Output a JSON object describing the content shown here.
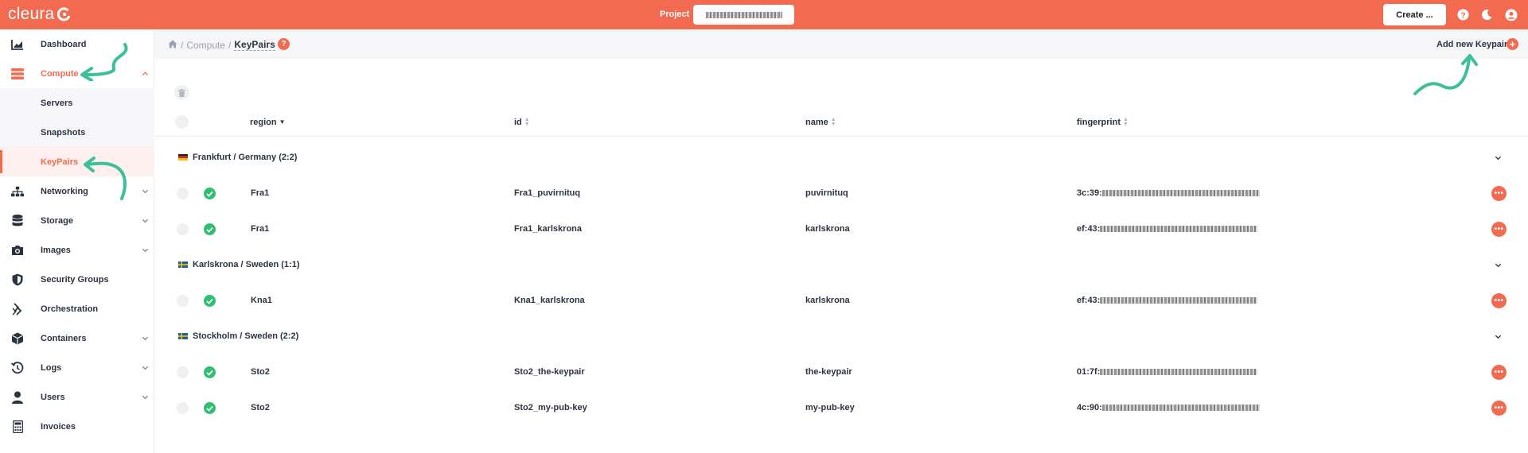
{
  "app": {
    "brand": "cleura"
  },
  "topbar": {
    "project_label": "Project",
    "create_label": "Create ..."
  },
  "sidebar": {
    "items": [
      {
        "label": "Dashboard"
      },
      {
        "label": "Compute"
      },
      {
        "label": "Servers"
      },
      {
        "label": "Snapshots"
      },
      {
        "label": "KeyPairs"
      },
      {
        "label": "Networking"
      },
      {
        "label": "Storage"
      },
      {
        "label": "Images"
      },
      {
        "label": "Security Groups"
      },
      {
        "label": "Orchestration"
      },
      {
        "label": "Containers"
      },
      {
        "label": "Logs"
      },
      {
        "label": "Users"
      },
      {
        "label": "Invoices"
      }
    ]
  },
  "breadcrumb": {
    "items": [
      "Compute",
      "KeyPairs"
    ],
    "help": "?"
  },
  "toolbar": {
    "add_label": "Add new Keypair"
  },
  "table": {
    "columns": [
      "region",
      "id",
      "name",
      "fingerprint"
    ],
    "groups": [
      {
        "label": "Frankfurt / Germany (2:2)",
        "rows": [
          {
            "region": "Fra1",
            "id": "Fra1_puvirnituq",
            "name": "puvirnituq",
            "fingerprint": "3c:39:"
          },
          {
            "region": "Fra1",
            "id": "Fra1_karlskrona",
            "name": "karlskrona",
            "fingerprint": "ef:43:"
          }
        ]
      },
      {
        "label": "Karlskrona / Sweden (1:1)",
        "rows": [
          {
            "region": "Kna1",
            "id": "Kna1_karlskrona",
            "name": "karlskrona",
            "fingerprint": "ef:43:"
          }
        ]
      },
      {
        "label": "Stockholm / Sweden (2:2)",
        "rows": [
          {
            "region": "Sto2",
            "id": "Sto2_the-keypair",
            "name": "the-keypair",
            "fingerprint": "01:7f:"
          },
          {
            "region": "Sto2",
            "id": "Sto2_my-pub-key",
            "name": "my-pub-key",
            "fingerprint": "4c:90:"
          }
        ]
      }
    ]
  },
  "colors": {
    "brand": "#f26a4f",
    "success": "#2fbf71",
    "annotation": "#3dbf9a"
  }
}
